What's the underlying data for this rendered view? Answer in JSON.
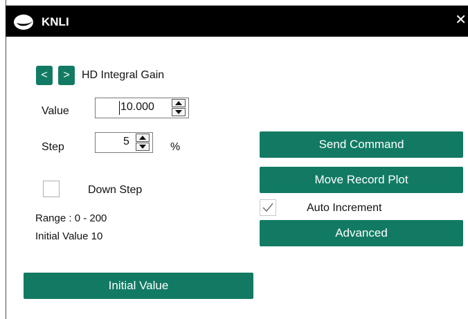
{
  "window": {
    "title": "KNLI",
    "close_glyph": "✕"
  },
  "param": {
    "prev_label": "<",
    "next_label": ">",
    "name": "HD Integral Gain"
  },
  "value_field": {
    "label": "Value",
    "value": "10.000"
  },
  "step_field": {
    "label": "Step",
    "value": "5",
    "unit": "%"
  },
  "down_step": {
    "label": "Down Step",
    "checked": false
  },
  "info": {
    "range": "Range : 0 - 200",
    "initial": "Initial Value 10"
  },
  "buttons": {
    "initial_value": "Initial Value",
    "send_command": "Send Command",
    "move_record_plot": "Move Record Plot",
    "advanced": "Advanced"
  },
  "auto_increment": {
    "label": "Auto Increment",
    "checked": true
  },
  "colors": {
    "accent": "#127a63",
    "titlebar": "#000000"
  }
}
